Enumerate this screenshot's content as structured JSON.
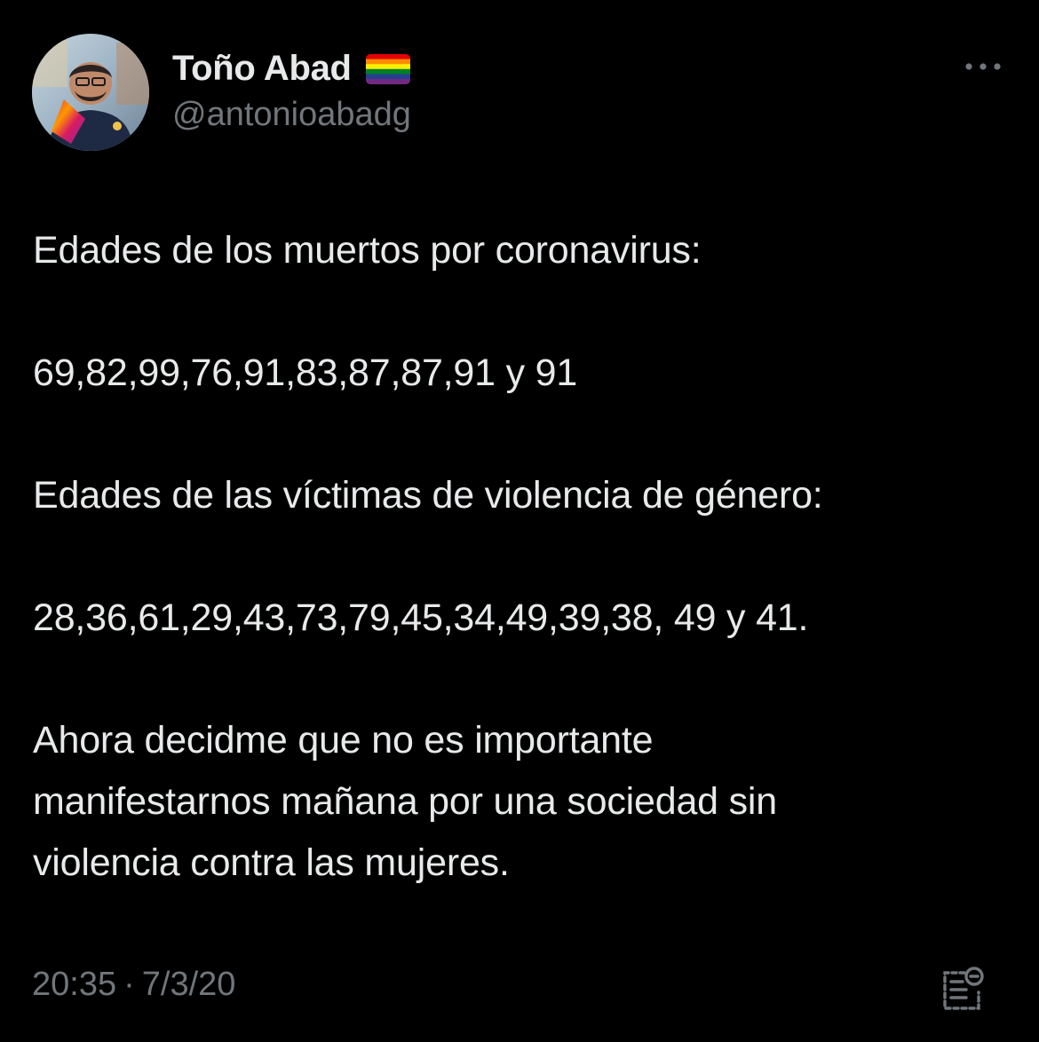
{
  "author": {
    "display_name": "Toño Abad",
    "handle": "@antonioabadg",
    "badge_icon": "rainbow-flag-icon"
  },
  "tweet": {
    "lines": {
      "intro_covid": "Edades de los muertos por coronavirus:",
      "covid_ages": "69,82,99,76,91,83,87,87,91 y 91",
      "intro_violence": "Edades de las víctimas de violencia de género:",
      "violence_ages": "28,36,61,29,43,73,79,45,34,49,39,38, 49 y 41.",
      "closing": [
        "Ahora decidme que no es importante",
        "manifestarnos mañana por una sociedad sin",
        "violencia contra las mujeres."
      ]
    }
  },
  "meta": {
    "time": "20:35",
    "separator": "·",
    "date": "7/3/20"
  },
  "icons": {
    "more": "more-dots-icon",
    "notes": "notes-icon"
  },
  "colors": {
    "background": "#000000",
    "primary_text": "#e7e9ea",
    "secondary_text": "#71767b"
  }
}
